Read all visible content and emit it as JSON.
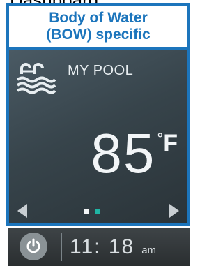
{
  "heading": "Dashboard:",
  "bow_label_line1": "Body of Water",
  "bow_label_line2": "(BOW) specific",
  "pool": {
    "icon": "pool-ladder-waves-icon",
    "name": "MY POOL",
    "temperature": "85",
    "degree_symbol": "°",
    "unit": "F"
  },
  "pager": {
    "total_pages": 2,
    "current_page": 2
  },
  "footer": {
    "power_icon": "power-icon",
    "time": "11: 18",
    "ampm": "am"
  },
  "colors": {
    "accent": "#1c75bc",
    "active_dot": "#1fb5a4",
    "screen_bg": "#37444b"
  }
}
